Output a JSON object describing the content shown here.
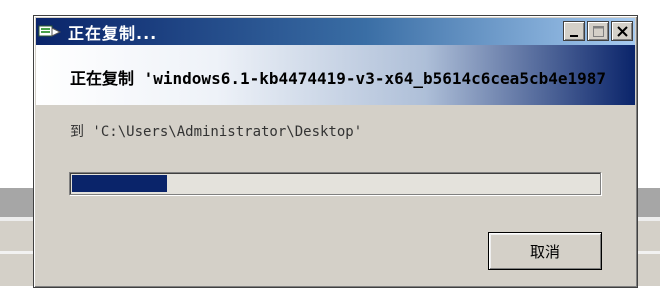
{
  "window": {
    "title": "正在复制...",
    "controls": {
      "minimize_icon": "minimize-icon",
      "maximize_icon": "maximize-icon",
      "close_icon": "close-icon"
    }
  },
  "header": {
    "text": "正在复制 'windows6.1-kb4474419-v3-x64_b5614c6cea5cb4e1987"
  },
  "destination": {
    "text": "到 'C:\\Users\\Administrator\\Desktop'"
  },
  "progress": {
    "fraction": 0.18
  },
  "buttons": {
    "cancel": "取消"
  },
  "colors": {
    "accent": "#0a246a",
    "face": "#d4d0c8"
  }
}
